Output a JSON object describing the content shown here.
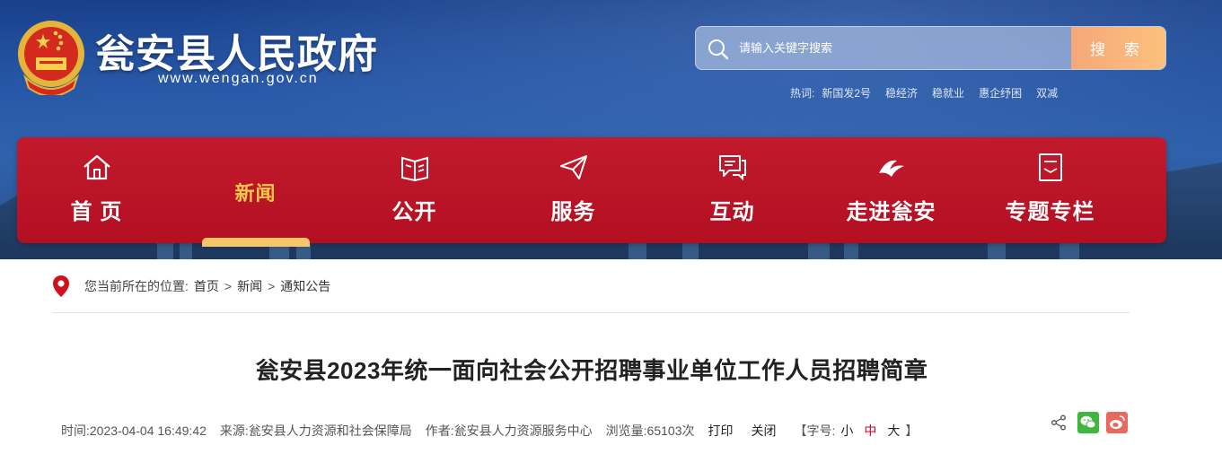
{
  "header": {
    "site_title": "瓮安县人民政府",
    "site_domain": "www.wengan.gov.cn",
    "search": {
      "placeholder": "请输入关键字搜索",
      "button_label": "搜 索"
    },
    "hotwords": {
      "label": "热词:",
      "items": [
        "新国发2号",
        "稳经济",
        "稳就业",
        "惠企纾困",
        "双减"
      ]
    }
  },
  "nav": {
    "items": [
      {
        "label": "首 页",
        "icon": "home-icon"
      },
      {
        "label": "新闻",
        "icon": "",
        "active": true
      },
      {
        "label": "公开",
        "icon": "book-icon"
      },
      {
        "label": "服务",
        "icon": "paper-plane-icon"
      },
      {
        "label": "互动",
        "icon": "chat-icon"
      },
      {
        "label": "走进瓮安",
        "icon": "wengan-logo-icon"
      },
      {
        "label": "专题专栏",
        "icon": "document-icon"
      }
    ],
    "colors": {
      "bar": "#b80f22",
      "active_text": "#ffc84a"
    }
  },
  "breadcrumb": {
    "prefix": "您当前所在的位置:",
    "items": [
      "首页",
      "新闻",
      "通知公告"
    ],
    "separator": ">"
  },
  "article": {
    "title": "瓮安县2023年统一面向社会公开招聘事业单位工作人员招聘简章",
    "meta": {
      "time": "时间:2023-04-04 16:49:42",
      "source": "来源:瓮安县人力资源和社会保障局",
      "author": "作者:瓮安县人力资源服务中心",
      "views": "浏览量:65103次",
      "print_label": "打印",
      "close_label": "关闭",
      "fontsize_prefix": "【字号:",
      "fontsize_options": [
        "小",
        "中",
        "大"
      ],
      "fontsize_selected": "中",
      "fontsize_suffix": "】"
    },
    "share": [
      "share-icon",
      "wechat-icon",
      "weibo-icon"
    ]
  }
}
